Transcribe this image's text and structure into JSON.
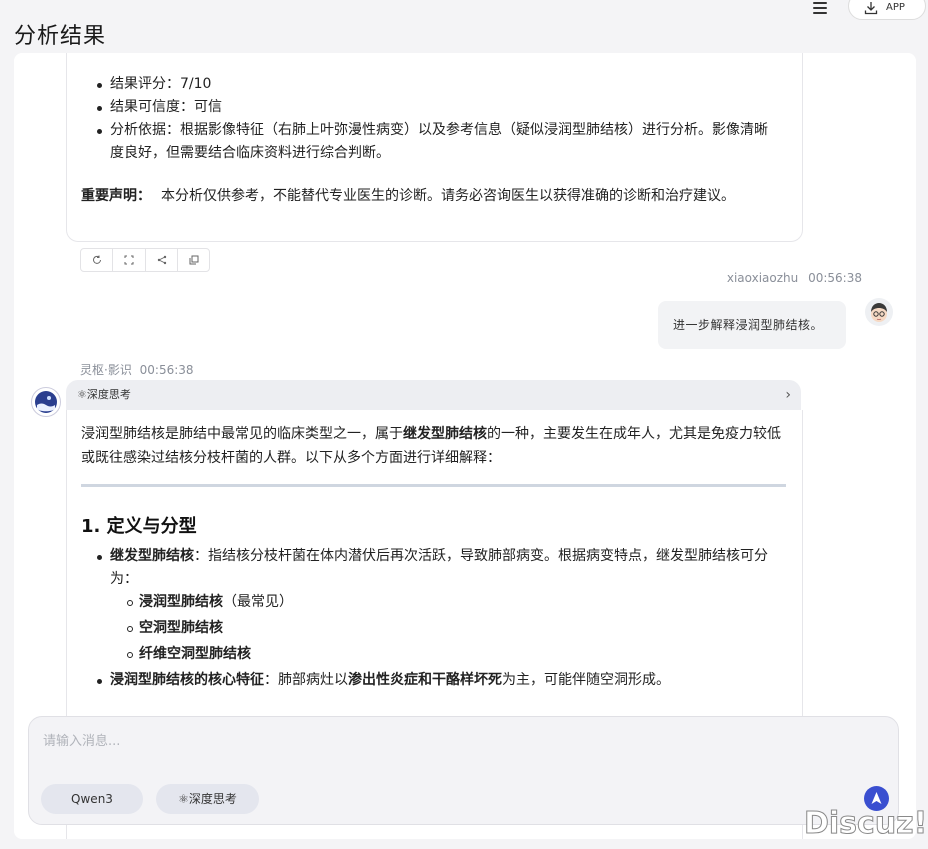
{
  "header": {
    "title": "分析结果",
    "app_label": "APP"
  },
  "previous_answer": {
    "bullets": [
      "结果评分：7/10",
      "结果可信度：可信",
      "分析依据：根据影像特征（右肺上叶弥漫性病变）以及参考信息（疑似浸润型肺结核）进行分析。影像清晰度良好，但需要结合临床资料进行综合判断。"
    ],
    "note_label": "重要声明：",
    "note_text": "本分析仅供参考，不能替代专业医生的诊断。请务必咨询医生以获得准确的诊断和治疗建议。",
    "action_icons": [
      "refresh-icon",
      "fullscreen-icon",
      "share-icon",
      "copy-icon"
    ]
  },
  "user_message": {
    "username": "xiaoxiaozhu",
    "time": "00:56:38",
    "text": "进一步解释浸润型肺结核。"
  },
  "bot_message": {
    "name": "灵枢·影识",
    "time": "00:56:38",
    "thinking_label": "深度思考",
    "intro_part1": "浸润型肺结核是肺结中最常见的临床类型之一，属于",
    "intro_bold": "继发型肺结核",
    "intro_part2": "的一种，主要发生在成年人，尤其是免疫力较低或既往感染过结核分枝杆菌的人群。以下从多个方面进行详细解释：",
    "section_heading": "1. 定义与分型",
    "item1_bold": "继发型肺结核",
    "item1_text": "：指结核分枝杆菌在体内潜伏后再次活跃，导致肺部病变。根据病变特点，继发型肺结核可分为：",
    "subtypes": [
      {
        "bold": "浸润型肺结核",
        "extra": "（最常见）"
      },
      {
        "bold": "空洞型肺结核",
        "extra": ""
      },
      {
        "bold": "纤维空洞型肺结核",
        "extra": ""
      }
    ],
    "item2_bold": "浸润型肺结核的核心特征",
    "item2_text1": "：肺部病灶以",
    "item2_bold2": "渗出性炎症和干酪样坏死",
    "item2_text2": "为主，可能伴随空洞形成。"
  },
  "composer": {
    "placeholder": "请输入消息...",
    "model_label": "Qwen3",
    "think_label": "深度思考"
  },
  "watermark": "Discuz!",
  "colors": {
    "accent": "#3a4fd0",
    "background": "#f4f4f6"
  }
}
